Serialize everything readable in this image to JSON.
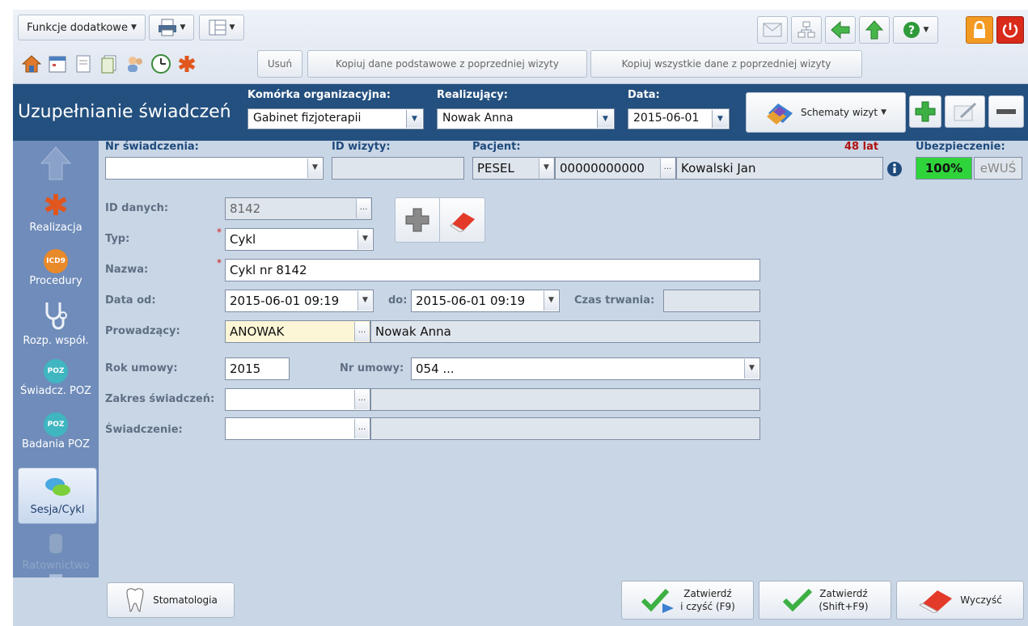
{
  "toolbar": {
    "functions_label": "Funkcje dodatkowe",
    "delete_label": "Usuń",
    "copy_basic_label": "Kopiuj dane podstawowe z poprzedniej wizyty",
    "copy_all_label": "Kopiuj wszystkie dane z poprzedniej wizyty"
  },
  "header": {
    "title": "Uzupełnianie świadczeń",
    "unit_label": "Komórka organizacyjna:",
    "unit_value": "Gabinet fizjoterapii",
    "performer_label": "Realizujący:",
    "performer_value": "Nowak Anna",
    "date_label": "Data:",
    "date_value": "2015-06-01",
    "schemes_label": "Schematy wizyt"
  },
  "patient_bar": {
    "service_no_label": "Nr świadczenia:",
    "visit_id_label": "ID wizyty:",
    "patient_label": "Pacjent:",
    "age": "48 lat",
    "insurance_label": "Ubezpieczenie:",
    "id_type": "PESEL",
    "pesel": "00000000000",
    "patient_name": "Kowalski Jan",
    "insurance_pct": "100%",
    "ewus": "eWUŚ"
  },
  "form": {
    "data_id_label": "ID danych:",
    "data_id_value": "8142",
    "type_label": "Typ:",
    "type_value": "Cykl",
    "name_label": "Nazwa:",
    "name_value": "Cykl nr 8142",
    "date_from_label": "Data od:",
    "date_from_value": "2015-06-01 09:19",
    "date_to_label": "do:",
    "date_to_value": "2015-06-01 09:19",
    "duration_label": "Czas trwania:",
    "duration_value": "",
    "leader_label": "Prowadzący:",
    "leader_code": "ANOWAK",
    "leader_name": "Nowak Anna",
    "contract_year_label": "Rok umowy:",
    "contract_year_value": "2015",
    "contract_no_label": "Nr umowy:",
    "contract_no_value": "054 ...",
    "scope_label": "Zakres świadczeń:",
    "scope_value": "",
    "service_label": "Świadczenie:",
    "service_value": ""
  },
  "sidebar": {
    "items": [
      {
        "label": "Realizacja",
        "icon": "asterisk-icon"
      },
      {
        "label": "Procedury",
        "icon": "icd9-icon",
        "badge": "ICD9"
      },
      {
        "label": "Rozp. współ.",
        "icon": "stethoscope-icon"
      },
      {
        "label": "Świadcz. POZ",
        "icon": "poz-icon",
        "badge": "POZ"
      },
      {
        "label": "Badania POZ",
        "icon": "poz-exam-icon",
        "badge": "POZ"
      },
      {
        "label": "Sesja/Cykl",
        "icon": "chat-bubbles-icon"
      },
      {
        "label": "Ratownictwo",
        "icon": "rescue-icon"
      }
    ]
  },
  "footer": {
    "dental_label": "Stomatologia",
    "confirm_clear_line1": "Zatwierdź",
    "confirm_clear_line2": "i czyść (F9)",
    "confirm_line1": "Zatwierdź",
    "confirm_line2": "(Shift+F9)",
    "clear_label": "Wyczyść"
  },
  "colors": {
    "header_bg": "#24507f",
    "sidebar_bg": "#6f8cba",
    "content_bg": "#c9d6e6",
    "insurance_green": "#2fd43a",
    "age_red": "#b01010"
  }
}
